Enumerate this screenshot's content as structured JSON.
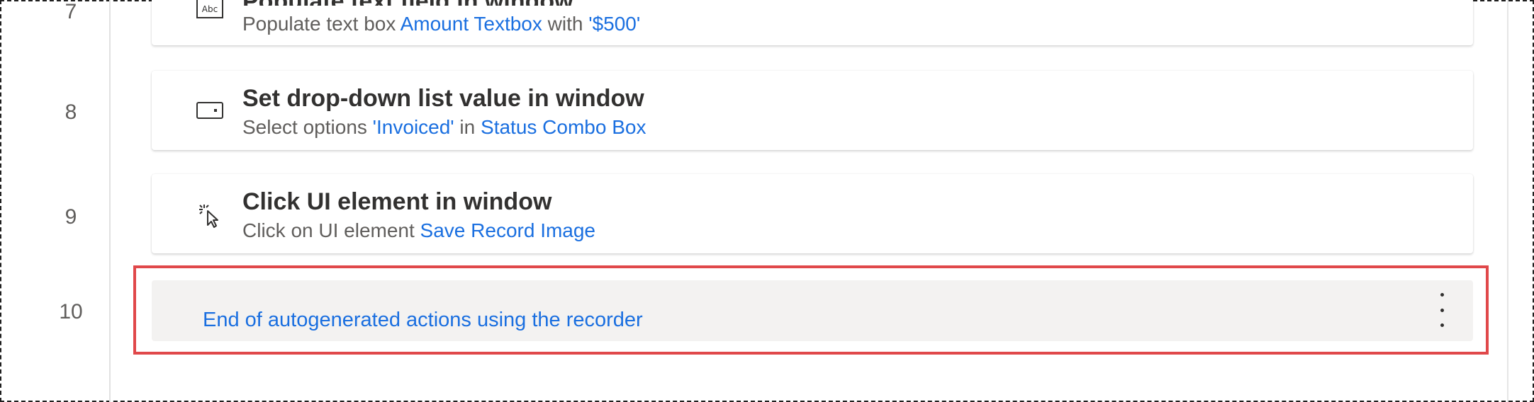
{
  "accent_color": "#1a6fe0",
  "highlight_color": "#e0484a",
  "rows": [
    {
      "number": "7",
      "icon": "textbox-icon",
      "title": "Populate text field in window",
      "desc_prefix": "Populate text box ",
      "desc_token1": "Amount Textbox",
      "desc_mid": " with ",
      "desc_token2": "'$500'"
    },
    {
      "number": "8",
      "icon": "dropdown-icon",
      "title": "Set drop-down list value in window",
      "desc_prefix": "Select options ",
      "desc_token1": "'Invoiced'",
      "desc_mid": " in ",
      "desc_token2": "Status Combo Box"
    },
    {
      "number": "9",
      "icon": "click-cursor-icon",
      "title": "Click UI element in window",
      "desc_prefix": "Click on UI element ",
      "desc_token1": "Save Record Image"
    },
    {
      "number": "10",
      "comment": "End of autogenerated actions using the recorder",
      "menu_icon": "more-vertical-icon"
    }
  ]
}
